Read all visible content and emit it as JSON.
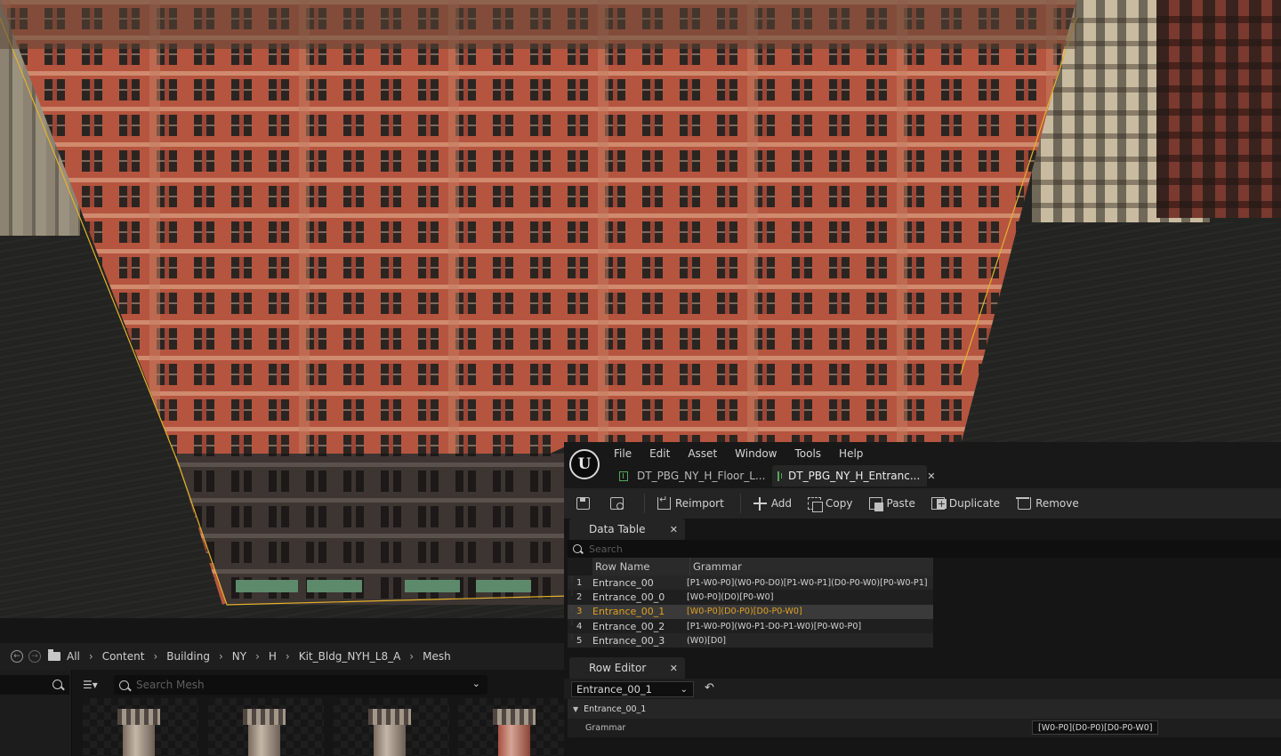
{
  "app": {
    "logo_letter": "U",
    "menu": [
      "File",
      "Edit",
      "Asset",
      "Window",
      "Tools",
      "Help"
    ],
    "tabs": [
      {
        "label": "DT_PBG_NY_H_Floor_L...",
        "active": false
      },
      {
        "label": "DT_PBG_NY_H_Entranc...",
        "active": true
      }
    ]
  },
  "toolbar": {
    "reimport": "Reimport",
    "add": "Add",
    "copy": "Copy",
    "paste": "Paste",
    "duplicate": "Duplicate",
    "remove": "Remove"
  },
  "data_table": {
    "panel_title": "Data Table",
    "search_placeholder": "Search",
    "columns": [
      "Row Name",
      "Grammar"
    ],
    "rows": [
      {
        "index": "1",
        "name": "Entrance_00",
        "grammar": "[P1-W0-P0](W0-P0-D0)[P1-W0-P1](D0-P0-W0)[P0-W0-P1]"
      },
      {
        "index": "2",
        "name": "Entrance_00_0",
        "grammar": "[W0-P0](D0)[P0-W0]"
      },
      {
        "index": "3",
        "name": "Entrance_00_1",
        "grammar": "[W0-P0](D0-P0)[D0-P0-W0]",
        "selected": true
      },
      {
        "index": "4",
        "name": "Entrance_00_2",
        "grammar": "[P1-W0-P0](W0-P1-D0-P1-W0)[P0-W0-P0]"
      },
      {
        "index": "5",
        "name": "Entrance_00_3",
        "grammar": "(W0)[D0]"
      }
    ]
  },
  "row_editor": {
    "panel_title": "Row Editor",
    "selected_row": "Entrance_00_1",
    "struct_label": "Entrance_00_1",
    "property_label": "Grammar",
    "property_value": "[W0-P0](D0-P0)[D0-P0-W0]"
  },
  "content_browser": {
    "breadcrumb": [
      "All",
      "Content",
      "Building",
      "NY",
      "H",
      "Kit_Bldg_NYH_L8_A",
      "Mesh"
    ],
    "search_placeholder": "Search Mesh"
  },
  "colors": {
    "accent_selected": "#e0a023",
    "brick": "#b5553f",
    "asset_icon": "#58a65c"
  }
}
